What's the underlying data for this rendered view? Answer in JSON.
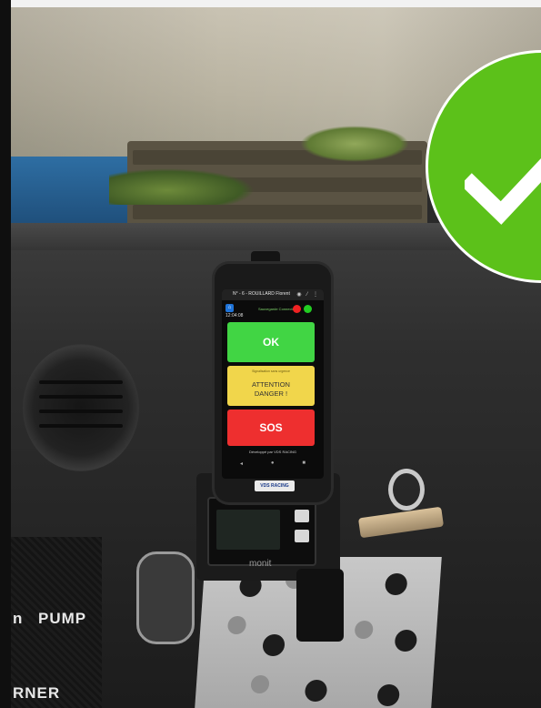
{
  "phone_app": {
    "title": "N° - 6 - ROUILLARD Florent",
    "clock": "12:04:08",
    "connection_status": "Sauvegarde Connecté",
    "buttons": {
      "ok_label": "OK",
      "attention_sub": "Signalisation sans urgence",
      "attention_line1": "ATTENTION",
      "attention_line2": "DANGER !",
      "sos_label": "SOS"
    },
    "footer": "Développé par VDS RACING"
  },
  "sticker_text": "VDS RACING",
  "device_brand": "monit",
  "panel_labels": {
    "pump": "PUMP",
    "n": "n",
    "rner": "RNER"
  },
  "colors": {
    "ok_green": "#41d544",
    "attention_yellow": "#f1d64b",
    "sos_red": "#ee2f2f",
    "check_badge": "#5cc11a"
  },
  "icons": {
    "badge": "checkmark-icon",
    "home": "home-icon",
    "call_end": "phone-hangup-icon",
    "call_accept": "phone-accept-icon"
  }
}
